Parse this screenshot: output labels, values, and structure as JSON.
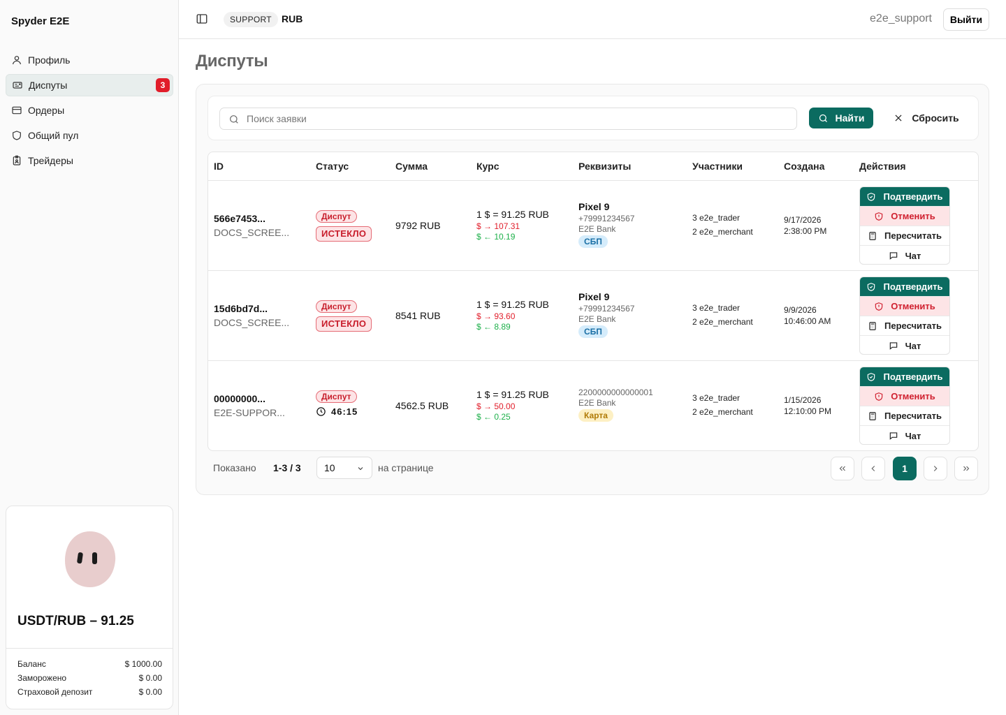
{
  "sidebar": {
    "brand": "Spyder E2E",
    "items": [
      {
        "label": "Профиль"
      },
      {
        "label": "Диспуты",
        "badge": "3"
      },
      {
        "label": "Ордеры"
      },
      {
        "label": "Общий пул"
      },
      {
        "label": "Трейдеры"
      }
    ],
    "rate_card": {
      "title": "USDT/RUB – 91.25",
      "rows": [
        {
          "label": "Баланс",
          "value": "$ 1000.00"
        },
        {
          "label": "Заморожено",
          "value": "$ 0.00"
        },
        {
          "label": "Страховой депозит",
          "value": "$ 0.00"
        }
      ]
    }
  },
  "header": {
    "role": "SUPPORT",
    "currency": "RUB",
    "username": "e2e_support",
    "logout_label": "Выйти"
  },
  "page": {
    "title": "Диспуты"
  },
  "search": {
    "placeholder": "Поиск заявки",
    "find_label": "Найти",
    "reset_label": "Сбросить"
  },
  "table": {
    "headers": [
      "ID",
      "Статус",
      "Сумма",
      "Курс",
      "Реквизиты",
      "Участники",
      "Создана",
      "Действия"
    ],
    "rows": [
      {
        "id": "566e7453...",
        "id_sub": "DOCS_SCREE...",
        "status1": "Диспут",
        "status2": "ИСТЕКЛО",
        "amount": "9792 RUB",
        "rate": "1 $ = 91.25 RUB",
        "rate_out": "$ → 107.31",
        "rate_in": "$ ← 10.19",
        "req_name": "Pixel 9",
        "req_phone": "+79991234567",
        "req_bank": "E2E Bank",
        "req_method": "СБП",
        "trader": "3 e2e_trader",
        "merchant": "2 e2e_merchant",
        "created_date": "9/17/2026",
        "created_time": "2:38:00 PM"
      },
      {
        "id": "15d6bd7d...",
        "id_sub": "DOCS_SCREE...",
        "status1": "Диспут",
        "status2": "ИСТЕКЛО",
        "amount": "8541 RUB",
        "rate": "1 $ = 91.25 RUB",
        "rate_out": "$ → 93.60",
        "rate_in": "$ ← 8.89",
        "req_name": "Pixel 9",
        "req_phone": "+79991234567",
        "req_bank": "E2E Bank",
        "req_method": "СБП",
        "trader": "3 e2e_trader",
        "merchant": "2 e2e_merchant",
        "created_date": "9/9/2026",
        "created_time": "10:46:00 AM"
      },
      {
        "id": "00000000...",
        "id_sub": "E2E-SUPPOR...",
        "status1": "Диспут",
        "timer": "46:15",
        "amount": "4562.5 RUB",
        "rate": "1 $ = 91.25 RUB",
        "rate_out": "$ → 50.00",
        "rate_in": "$ ← 0.25",
        "req_card": "2200000000000001",
        "req_bank": "E2E Bank",
        "req_method": "Карта",
        "trader": "3 e2e_trader",
        "merchant": "2 e2e_merchant",
        "created_date": "1/15/2026",
        "created_time": "12:10:00 PM"
      }
    ],
    "actions": {
      "confirm": "Подтвердить",
      "cancel": "Отменить",
      "recalc": "Пересчитать",
      "chat": "Чат"
    }
  },
  "pagination": {
    "shown_label": "Показано",
    "shown_count": "1-3 / 3",
    "per_page": "10",
    "per_page_label": "на странице",
    "current_page": "1"
  },
  "colors": {
    "accent": "#0b6b60",
    "danger": "#e11d2a",
    "success": "#1db04a"
  }
}
